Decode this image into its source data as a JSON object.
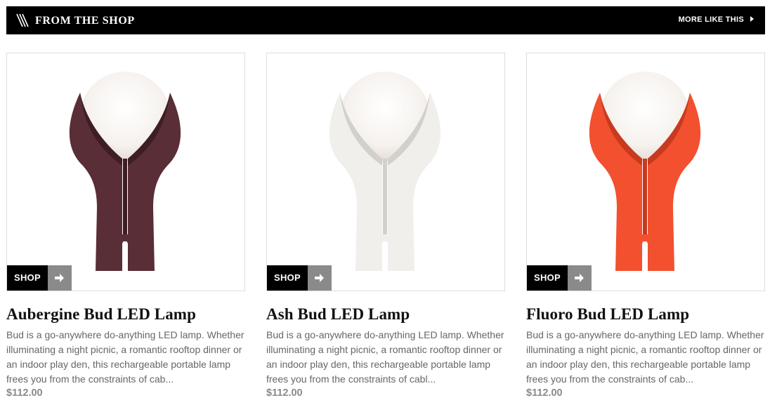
{
  "header": {
    "title": "FROM THE SHOP",
    "more_label": "MORE LIKE THIS",
    "logo_icon": "slashes-logo-icon",
    "more_icon": "triangle-right-icon"
  },
  "products": [
    {
      "name": "Aubergine Bud LED Lamp",
      "description": "Bud is a go-anywhere do-anything LED lamp. Whether illuminating a night picnic, a romantic rooftop dinner or an indoor play den, this rechargeable portable lamp frees you from the constraints of cab...",
      "price": "$112.00",
      "shop_label": "SHOP",
      "color": "#5a2e36",
      "color_shade": "#3e1e24"
    },
    {
      "name": "Ash Bud LED Lamp",
      "description": "Bud is a go-anywhere do-anything LED lamp. Whether illuminating a night picnic, a romantic rooftop dinner or an indoor play den, this rechargeable portable lamp frees you from the constraints of cabl...",
      "price": "$112.00",
      "shop_label": "SHOP",
      "color": "#f0efeb",
      "color_shade": "#d2d0cb"
    },
    {
      "name": "Fluoro Bud LED Lamp",
      "description": "Bud is a go-anywhere do-anything LED lamp. Whether illuminating a night picnic, a romantic rooftop dinner or an indoor play den, this rechargeable portable lamp frees you from the constraints of cab...",
      "price": "$112.00",
      "shop_label": "SHOP",
      "color": "#f2502f",
      "color_shade": "#c73a20"
    }
  ]
}
